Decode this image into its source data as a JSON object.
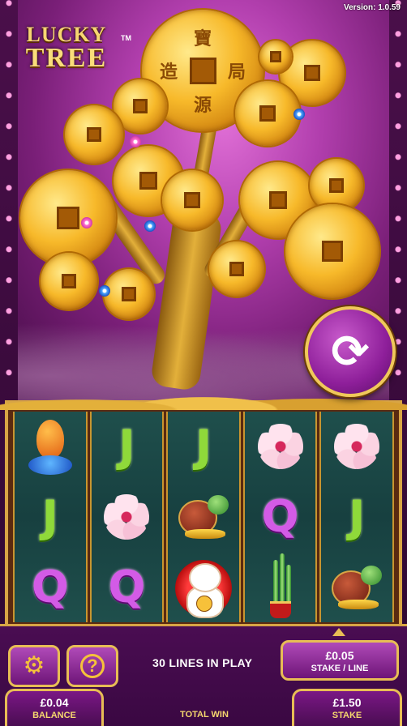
{
  "app": {
    "version": "Version: 1.0.59",
    "logo_lucky": "LUCKY",
    "logo_tree": "TREE",
    "logo_tm": "TM"
  },
  "icons": {
    "spin": "refresh-icon",
    "settings": "gear-icon",
    "help": "question-icon"
  },
  "reels": [
    [
      "koi-fish",
      "J",
      "Q"
    ],
    [
      "J",
      "cherry-blossom",
      "Q"
    ],
    [
      "J",
      "turtle",
      "lucky-cat"
    ],
    [
      "cherry-blossom",
      "Q",
      "bamboo"
    ],
    [
      "cherry-blossom",
      "J",
      "turtle"
    ]
  ],
  "controls": {
    "lines_text": "30 LINES IN PLAY",
    "stake_per_line_value": "£0.05",
    "stake_per_line_label": "STAKE / LINE"
  },
  "meters": {
    "balance_value": "£0.04",
    "balance_label": "BALANCE",
    "total_win_label": "TOTAL WIN",
    "stake_value": "£1.50",
    "stake_label": "STAKE"
  },
  "coin_glyphs": [
    "寶",
    "造",
    "局",
    "源"
  ],
  "colors": {
    "gold": "#e8bd55",
    "purple": "#6e1578",
    "reel_bg": "#174040"
  }
}
